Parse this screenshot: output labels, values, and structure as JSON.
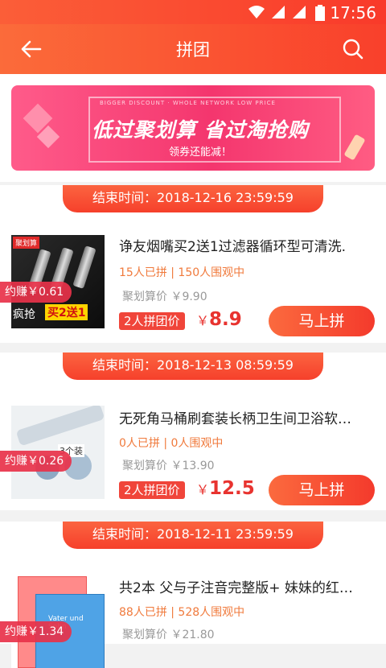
{
  "status_bar": {
    "time": "17:56"
  },
  "header": {
    "title": "拼团"
  },
  "banner": {
    "small_text": "BIGGER DISCOUNT · WHOLE NETWORK LOW PRICE",
    "slogan": "低过聚划算 省过淘抢购",
    "subtitle": "领券还能减！"
  },
  "products": [
    {
      "end_label": "结束时间：",
      "end_time": "2018-12-16 23:59:59",
      "title": "诤友烟嘴买2送1过滤器循环型可清洗.",
      "stats": "15人已拼 | 150人围观中",
      "ref_price": "聚划算价 ￥9.90",
      "group_label": "2人拼团价",
      "price_symbol": "￥",
      "price": "8.9",
      "buy_label": "马上拼",
      "earn": "约赚￥0.61",
      "thumb_badge": "聚划算",
      "thumb_text1": "疯抢",
      "thumb_text2": "买2送1"
    },
    {
      "end_label": "结束时间：",
      "end_time": "2018-12-13 08:59:59",
      "title": "无死角马桶刷套装长柄卫生间卫浴软…",
      "stats": "0人已拼 | 0人围观中",
      "ref_price": "聚划算价 ￥13.90",
      "group_label": "2人拼团价",
      "price_symbol": "￥",
      "price": "12.5",
      "buy_label": "马上拼",
      "earn": "约赚￥0.26",
      "thumb_text1": "3个装"
    },
    {
      "end_label": "结束时间：",
      "end_time": "2018-12-11 23:59:59",
      "title": "共2本 父与子注音完整版+ 妹妹的红…",
      "stats": "88人已拼 | 528人围观中",
      "ref_price": "聚划算价 ￥21.80",
      "earn": "约赚￥1.34",
      "thumb_text1": "Vater und Sohn"
    }
  ],
  "colors": {
    "accent": "#f9402b",
    "stats": "#f07a3c",
    "price": "#e8332f"
  }
}
